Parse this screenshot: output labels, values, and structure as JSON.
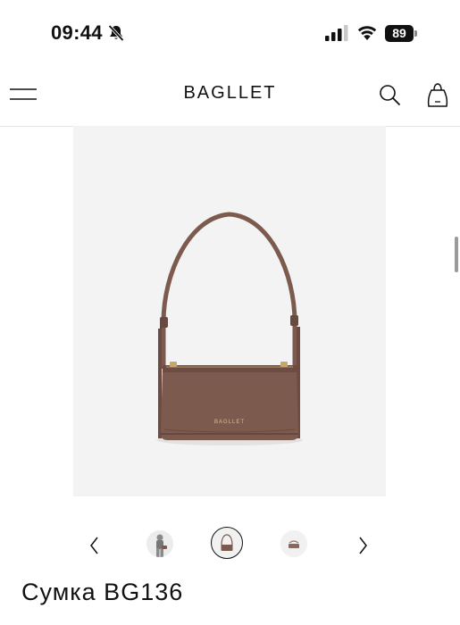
{
  "status_bar": {
    "time": "09:44",
    "battery": "89",
    "icons": [
      "bell-slash-icon",
      "signal-icon",
      "wifi-icon",
      "battery-icon"
    ]
  },
  "header": {
    "brand": "BAGLLET",
    "icons": [
      "menu-icon",
      "search-icon",
      "shopping-bag-icon"
    ]
  },
  "product": {
    "image_brand_mark": "BAGLLET",
    "image_colors": {
      "bag": "#7d5a4e",
      "background": "#f3f3f3"
    },
    "title": "Сумка BG136"
  },
  "gallery": {
    "thumbnails": [
      "model-wearing-bag",
      "bag-front",
      "bag-top"
    ],
    "active_index": 1,
    "prev_icon": "chevron-left-icon",
    "next_icon": "chevron-right-icon"
  }
}
